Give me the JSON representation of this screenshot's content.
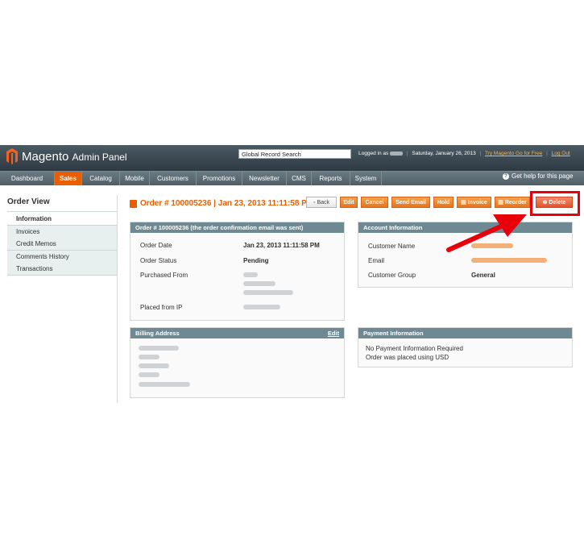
{
  "header": {
    "logo_word": "Magento",
    "logo_sub": "Admin Panel",
    "search_placeholder": "Global Record Search",
    "logged_in_prefix": "Logged in as",
    "date": "Saturday, January 26, 2013",
    "try_link": "Try Magento Go for Free",
    "logout": "Log Out"
  },
  "nav": {
    "items": [
      "Dashboard",
      "Sales",
      "Catalog",
      "Mobile",
      "Customers",
      "Promotions",
      "Newsletter",
      "CMS",
      "Reports",
      "System"
    ],
    "active": "Sales",
    "help": "Get help for this page"
  },
  "sidebar": {
    "title": "Order View",
    "items": [
      "Information",
      "Invoices",
      "Credit Memos",
      "Comments History",
      "Transactions"
    ]
  },
  "page": {
    "title": "Order # 100005236 | Jan 23, 2013 11:11:58 PM",
    "buttons": [
      "Back",
      "Edit",
      "Cancel",
      "Send Email",
      "Hold",
      "Invoice",
      "Reorder",
      "Delete"
    ]
  },
  "order_box": {
    "header": "Order # 100005236 (the order confirmation email was sent)",
    "date_label": "Order Date",
    "date_value": "Jan 23, 2013 11:11:58 PM",
    "status_label": "Order Status",
    "status_value": "Pending",
    "purchased_label": "Purchased From",
    "ip_label": "Placed from IP"
  },
  "account_box": {
    "header": "Account Information",
    "name_label": "Customer Name",
    "email_label": "Email",
    "group_label": "Customer Group",
    "group_value": "General"
  },
  "billing_box": {
    "header": "Billing Address",
    "edit": "Edit"
  },
  "payment_box": {
    "header": "Payment Information",
    "line1": "No Payment Information Required",
    "line2": "Order was placed using USD"
  },
  "colors": {
    "accent": "#eb5e00",
    "highlight": "#e8000b",
    "box_header": "#6f8992"
  }
}
